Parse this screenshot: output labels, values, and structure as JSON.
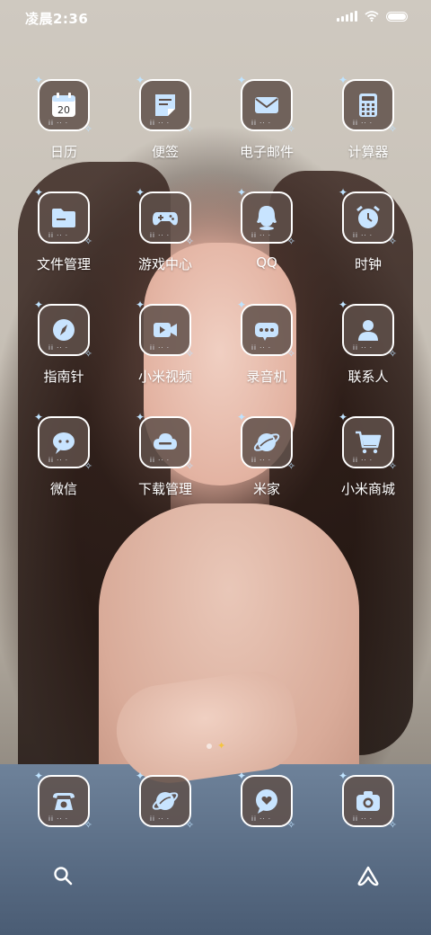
{
  "status_bar": {
    "time": "凌晨2:36",
    "icons": [
      "signal-icon",
      "wifi-icon",
      "battery-icon"
    ]
  },
  "apps": [
    {
      "label": "日历",
      "icon": "calendar-icon",
      "badge_text": "20"
    },
    {
      "label": "便签",
      "icon": "notes-icon"
    },
    {
      "label": "电子邮件",
      "icon": "mail-icon"
    },
    {
      "label": "计算器",
      "icon": "calculator-icon"
    },
    {
      "label": "文件管理",
      "icon": "folder-icon"
    },
    {
      "label": "游戏中心",
      "icon": "gamepad-icon"
    },
    {
      "label": "QQ",
      "icon": "qq-icon"
    },
    {
      "label": "时钟",
      "icon": "alarm-clock-icon"
    },
    {
      "label": "指南针",
      "icon": "compass-icon"
    },
    {
      "label": "小米视频",
      "icon": "video-icon"
    },
    {
      "label": "录音机",
      "icon": "recorder-icon"
    },
    {
      "label": "联系人",
      "icon": "contact-icon"
    },
    {
      "label": "微信",
      "icon": "wechat-icon"
    },
    {
      "label": "下载管理",
      "icon": "download-icon"
    },
    {
      "label": "米家",
      "icon": "planet-icon"
    },
    {
      "label": "小米商城",
      "icon": "cart-icon"
    }
  ],
  "tile_decoration": {
    "dots": "ii ·· ·"
  },
  "page_indicator": {
    "pages": 2,
    "current": 1
  },
  "dock": [
    {
      "icon": "phone-icon"
    },
    {
      "icon": "browser-icon"
    },
    {
      "icon": "message-icon"
    },
    {
      "icon": "camera-icon"
    }
  ],
  "nav": [
    "search-icon",
    "assistant-icon"
  ],
  "colors": {
    "tile_bg": "#5f504a",
    "tile_border": "#ffffff",
    "glyph": "#c8e4ff",
    "sparkle": "#f4c440"
  }
}
